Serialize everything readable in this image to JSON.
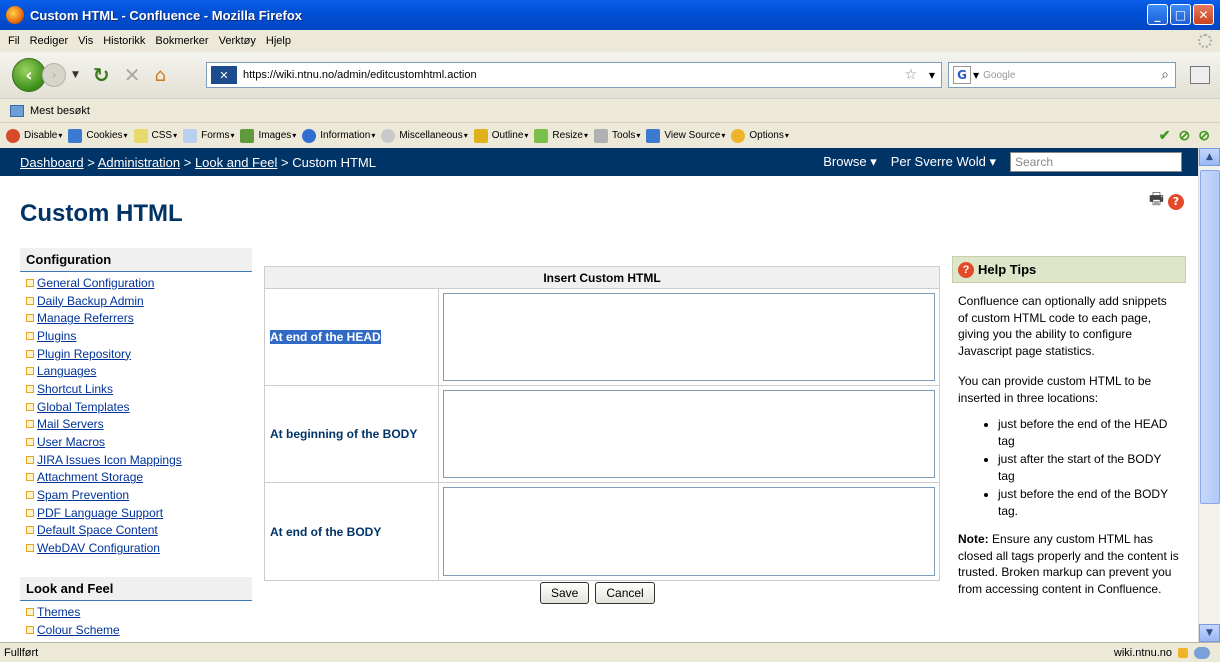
{
  "window": {
    "title": "Custom HTML - Confluence - Mozilla Firefox"
  },
  "menubar": {
    "items": [
      "Fil",
      "Rediger",
      "Vis",
      "Historikk",
      "Bokmerker",
      "Verktøy",
      "Hjelp"
    ]
  },
  "nav": {
    "url": "https://wiki.ntnu.no/admin/editcustomhtml.action",
    "search_placeholder": "Google"
  },
  "bookmarks": {
    "item": "Mest besøkt"
  },
  "devbar": {
    "items": [
      "Disable",
      "Cookies",
      "CSS",
      "Forms",
      "Images",
      "Information",
      "Miscellaneous",
      "Outline",
      "Resize",
      "Tools",
      "View Source",
      "Options"
    ]
  },
  "header": {
    "crumbs": [
      "Dashboard",
      "Administration",
      "Look and Feel"
    ],
    "current": "Custom HTML",
    "browse": "Browse",
    "user": "Per Sverre Wold",
    "search_placeholder": "Search"
  },
  "page": {
    "title": "Custom HTML"
  },
  "leftnav": {
    "config_title": "Configuration",
    "config_items": [
      "General Configuration",
      "Daily Backup Admin",
      "Manage Referrers",
      "Plugins",
      "Plugin Repository",
      "Languages",
      "Shortcut Links",
      "Global Templates",
      "Mail Servers",
      "User Macros",
      "JIRA Issues Icon Mappings",
      "Attachment Storage",
      "Spam Prevention",
      "PDF Language Support",
      "Default Space Content",
      "WebDAV Configuration"
    ],
    "laf_title": "Look and Feel",
    "laf_items": [
      "Themes",
      "Colour Scheme"
    ]
  },
  "form": {
    "heading": "Insert Custom HTML",
    "rows": [
      {
        "label": "At end of the HEAD"
      },
      {
        "label": "At beginning of the BODY"
      },
      {
        "label": "At end of the BODY"
      }
    ],
    "save": "Save",
    "cancel": "Cancel"
  },
  "help": {
    "title": "Help Tips",
    "p1": "Confluence can optionally add snippets of custom HTML code to each page, giving you the ability to configure Javascript page statistics.",
    "p2": "You can provide custom HTML to be inserted in three locations:",
    "bullets": [
      "just before the end of the HEAD tag",
      "just after the start of the BODY tag",
      "just before the end of the BODY tag."
    ],
    "note_label": "Note:",
    "note": "Ensure any custom HTML has closed all tags properly and the content is trusted. Broken markup can prevent you from accessing content in Confluence."
  },
  "status": {
    "left": "Fullført",
    "host": "wiki.ntnu.no"
  }
}
